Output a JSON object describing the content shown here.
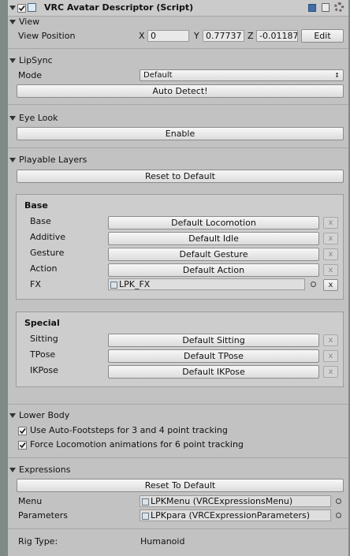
{
  "component": {
    "title": "VRC Avatar Descriptor (Script)"
  },
  "view": {
    "header": "View",
    "position_label": "View Position",
    "x_label": "X",
    "x_value": "0",
    "y_label": "Y",
    "y_value": "0.77737",
    "z_label": "Z",
    "z_value": "-0.01187",
    "edit_label": "Edit"
  },
  "lipsync": {
    "header": "LipSync",
    "mode_label": "Mode",
    "mode_value": "Default",
    "auto_detect_label": "Auto Detect!"
  },
  "eyelook": {
    "header": "Eye Look",
    "enable_label": "Enable"
  },
  "playable": {
    "header": "Playable Layers",
    "reset_label": "Reset to Default",
    "base": {
      "title": "Base",
      "rows": [
        {
          "label": "Base",
          "value": "Default Locomotion"
        },
        {
          "label": "Additive",
          "value": "Default Idle"
        },
        {
          "label": "Gesture",
          "value": "Default Gesture"
        },
        {
          "label": "Action",
          "value": "Default Action"
        }
      ],
      "fx_label": "FX",
      "fx_value": "LPK_FX"
    },
    "special": {
      "title": "Special",
      "rows": [
        {
          "label": "Sitting",
          "value": "Default Sitting"
        },
        {
          "label": "TPose",
          "value": "Default TPose"
        },
        {
          "label": "IKPose",
          "value": "Default IKPose"
        }
      ]
    },
    "x_glyph": "x"
  },
  "lowerbody": {
    "header": "Lower Body",
    "autofoot_label": "Use Auto-Footsteps for 3 and 4 point tracking",
    "forceloco_label": "Force Locomotion animations for 6 point tracking"
  },
  "expressions": {
    "header": "Expressions",
    "reset_label": "Reset To Default",
    "menu_label": "Menu",
    "menu_value": "LPKMenu (VRCExpressionsMenu)",
    "params_label": "Parameters",
    "params_value": "LPKpara (VRCExpressionParameters)"
  },
  "rig": {
    "label": "Rig Type:",
    "value": "Humanoid"
  }
}
